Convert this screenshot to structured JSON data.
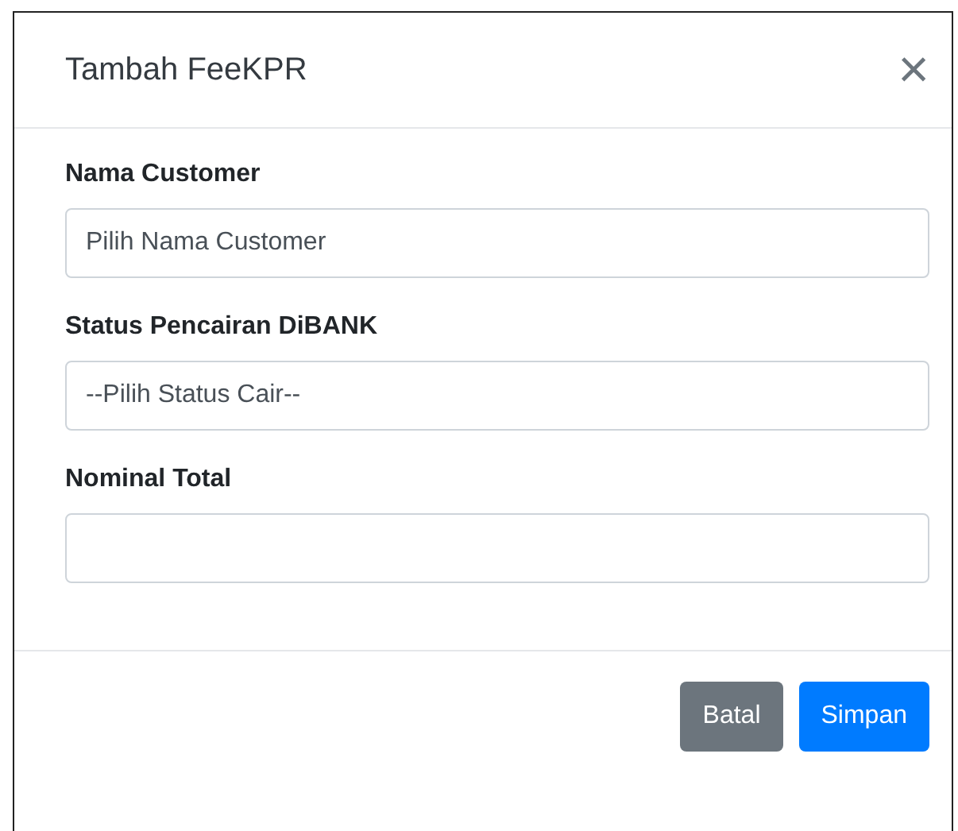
{
  "dialog": {
    "title": "Tambah FeeKPR",
    "close": "×"
  },
  "fields": [
    {
      "label": "Nama Customer",
      "value": "Pilih Nama Customer"
    },
    {
      "label": "Status Pencairan DiBANK",
      "value": "--Pilih Status Cair--"
    },
    {
      "label": "Nominal Total"
    }
  ],
  "buttons": [
    {
      "label": "Batal",
      "kind": "secondary"
    },
    {
      "label": "Simpan",
      "kind": "primary"
    }
  ]
}
